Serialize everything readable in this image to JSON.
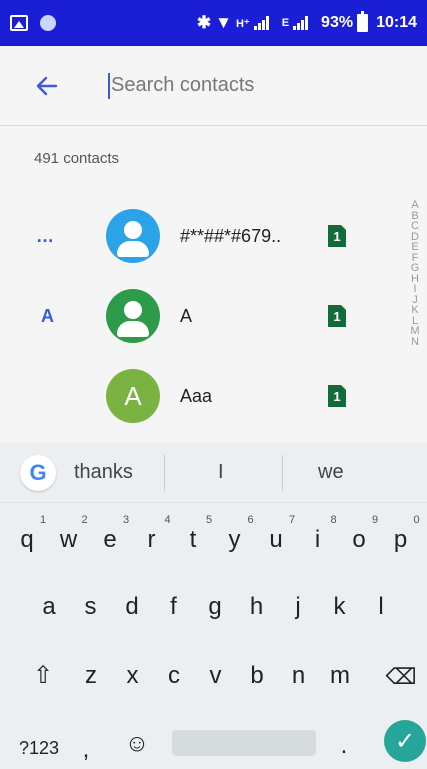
{
  "status_bar": {
    "battery": "93%",
    "time": "10:14",
    "net_type_1": "H⁺",
    "net_type_2": "E"
  },
  "search": {
    "placeholder": "Search contacts"
  },
  "contact_count": "491 contacts",
  "contacts": [
    {
      "section": "…",
      "name": "#**##*#679..",
      "avatar": "person-icon",
      "color": "#2aa3e8",
      "sim": "1"
    },
    {
      "section": "A",
      "name": "A",
      "avatar": "person-icon",
      "color": "#2e9b4a",
      "sim": "1"
    },
    {
      "section": "",
      "name": "Aaa",
      "initial": "A",
      "color": "#7ab342",
      "sim": "1"
    }
  ],
  "alphabet_index": [
    "A",
    "B",
    "C",
    "D",
    "E",
    "F",
    "G",
    "H",
    "I",
    "J",
    "K",
    "L",
    "M",
    "N"
  ],
  "keyboard": {
    "suggestions": [
      "thanks",
      "I",
      "we"
    ],
    "row1": [
      {
        "k": "q",
        "n": "1"
      },
      {
        "k": "w",
        "n": "2"
      },
      {
        "k": "e",
        "n": "3"
      },
      {
        "k": "r",
        "n": "4"
      },
      {
        "k": "t",
        "n": "5"
      },
      {
        "k": "y",
        "n": "6"
      },
      {
        "k": "u",
        "n": "7"
      },
      {
        "k": "i",
        "n": "8"
      },
      {
        "k": "o",
        "n": "9"
      },
      {
        "k": "p",
        "n": "0"
      }
    ],
    "row2": [
      "a",
      "s",
      "d",
      "f",
      "g",
      "h",
      "j",
      "k",
      "l"
    ],
    "row3": [
      "z",
      "x",
      "c",
      "v",
      "b",
      "n",
      "m"
    ],
    "symbols_key": "?123",
    "comma_key": ",",
    "period_key": "."
  }
}
